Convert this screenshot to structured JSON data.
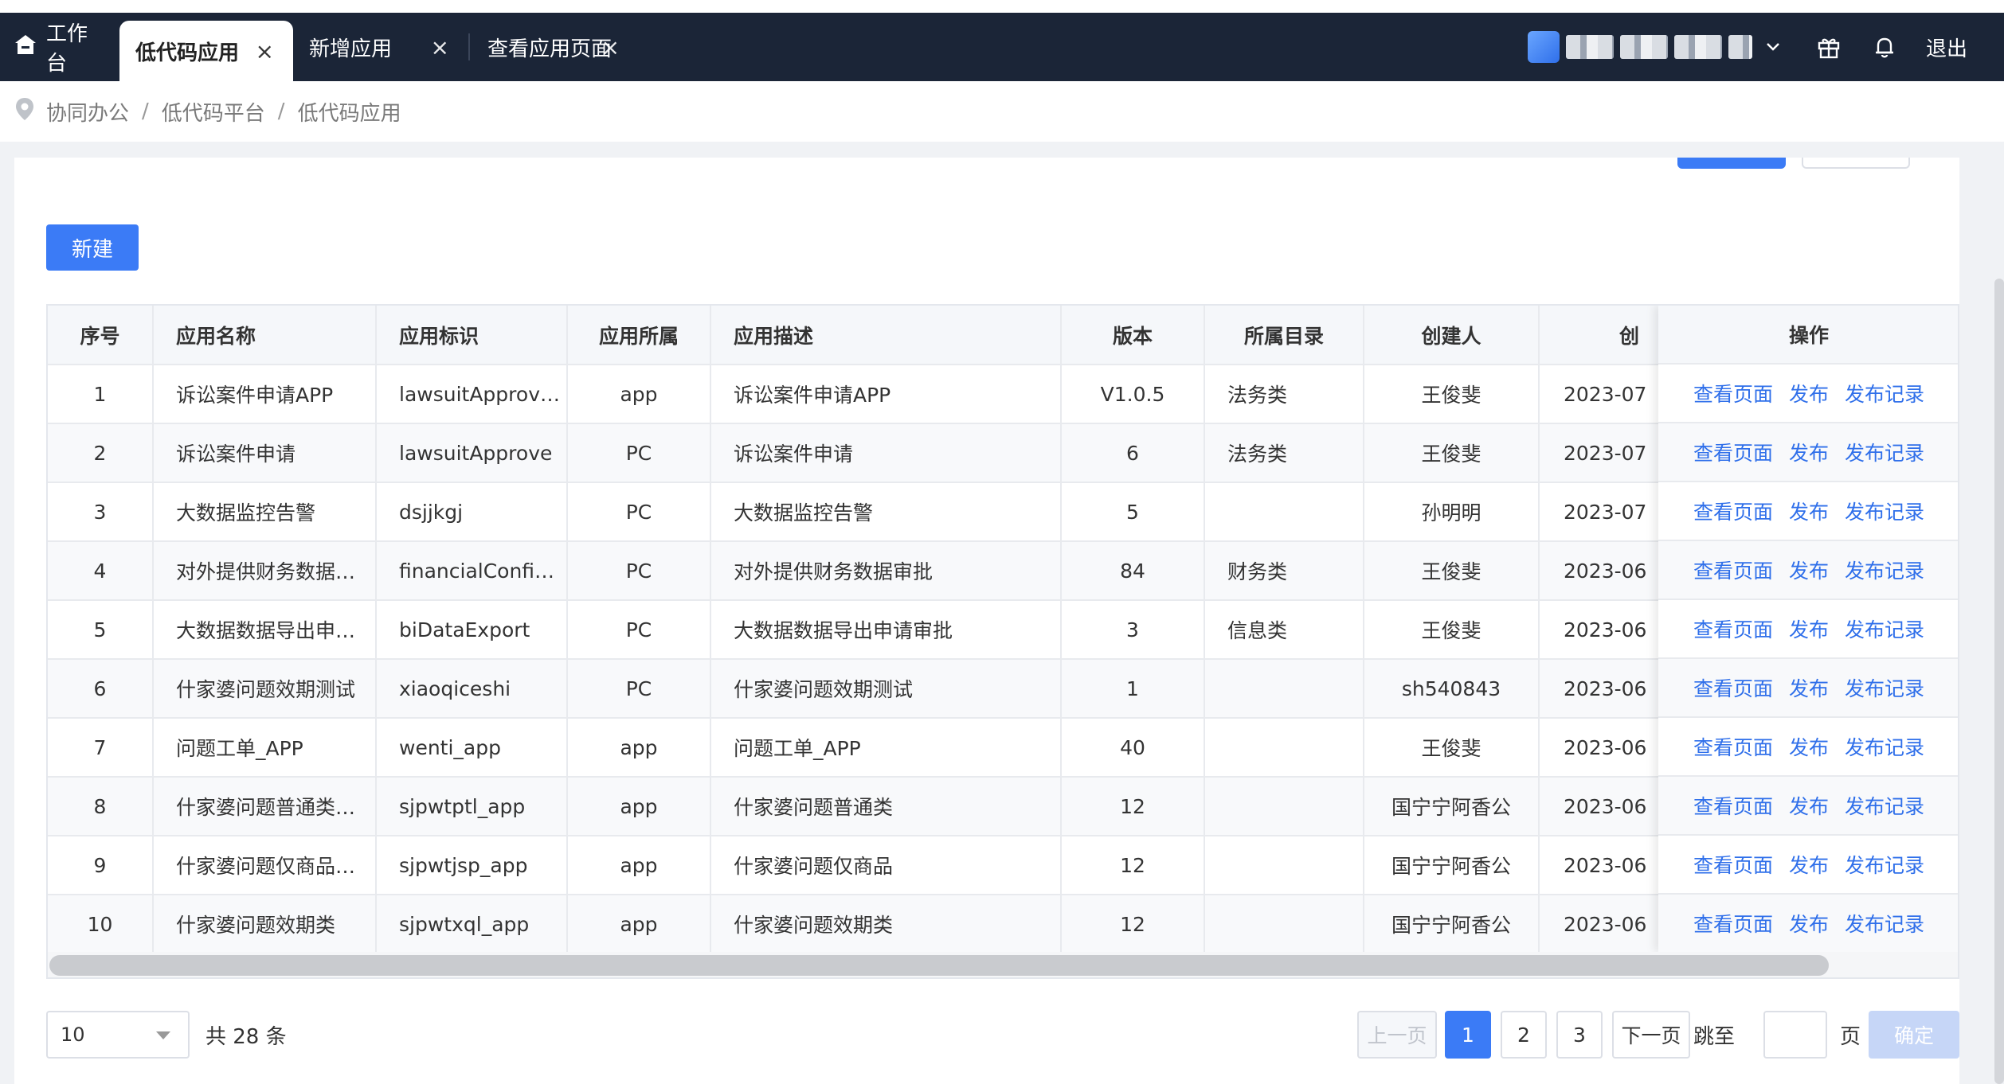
{
  "topbar": {
    "tabs": [
      {
        "label": "工作台"
      },
      {
        "label": "低代码应用"
      },
      {
        "label": "新增应用"
      },
      {
        "label": "查看应用页面"
      }
    ],
    "logout": "退出"
  },
  "breadcrumb": [
    "协同办公",
    "低代码平台",
    "低代码应用"
  ],
  "toolbar": {
    "new_label": "新建"
  },
  "table": {
    "headers": [
      "序号",
      "应用名称",
      "应用标识",
      "应用所属",
      "应用描述",
      "版本",
      "所属目录",
      "创建人",
      "创"
    ],
    "ops_header": "操作",
    "ops_links": [
      "查看页面",
      "发布",
      "发布记录"
    ],
    "rows": [
      [
        "1",
        "诉讼案件申请APP",
        "lawsuitApprov…",
        "app",
        "诉讼案件申请APP",
        "V1.0.5",
        "法务类",
        "王俊斐",
        "2023-07"
      ],
      [
        "2",
        "诉讼案件申请",
        "lawsuitApprove",
        "PC",
        "诉讼案件申请",
        "6",
        "法务类",
        "王俊斐",
        "2023-07"
      ],
      [
        "3",
        "大数据监控告警",
        "dsjjkgj",
        "PC",
        "大数据监控告警",
        "5",
        "",
        "孙明明",
        "2023-07"
      ],
      [
        "4",
        "对外提供财务数据…",
        "financialConfi…",
        "PC",
        "对外提供财务数据审批",
        "84",
        "财务类",
        "王俊斐",
        "2023-06"
      ],
      [
        "5",
        "大数据数据导出申…",
        "biDataExport",
        "PC",
        "大数据数据导出申请审批",
        "3",
        "信息类",
        "王俊斐",
        "2023-06"
      ],
      [
        "6",
        "什家婆问题效期测试",
        "xiaoqiceshi",
        "PC",
        "什家婆问题效期测试",
        "1",
        "",
        "sh540843",
        "2023-06"
      ],
      [
        "7",
        "问题工单_APP",
        "wenti_app",
        "app",
        "问题工单_APP",
        "40",
        "",
        "王俊斐",
        "2023-06"
      ],
      [
        "8",
        "什家婆问题普通类…",
        "sjpwtptl_app",
        "app",
        "什家婆问题普通类",
        "12",
        "",
        "国宁宁阿香公",
        "2023-06"
      ],
      [
        "9",
        "什家婆问题仅商品…",
        "sjpwtjsp_app",
        "app",
        "什家婆问题仅商品",
        "12",
        "",
        "国宁宁阿香公",
        "2023-06"
      ],
      [
        "10",
        "什家婆问题效期类",
        "sjpwtxql_app",
        "app",
        "什家婆问题效期类",
        "12",
        "",
        "国宁宁阿香公",
        "2023-06"
      ]
    ]
  },
  "pagination": {
    "page_size": "10",
    "total": "共 28 条",
    "prev": "上一页",
    "pages": [
      "1",
      "2",
      "3"
    ],
    "current_page": "1",
    "next": "下一页",
    "jump_label": "跳至",
    "page_unit": "页",
    "confirm": "确定"
  },
  "colors": {
    "accent": "#3b7bf6",
    "topbar": "#1b2537",
    "link": "#2f6fea"
  },
  "icons": [
    "home-icon",
    "close-icon",
    "location-pin-icon",
    "gift-icon",
    "bell-icon",
    "chevron-down-icon"
  ]
}
